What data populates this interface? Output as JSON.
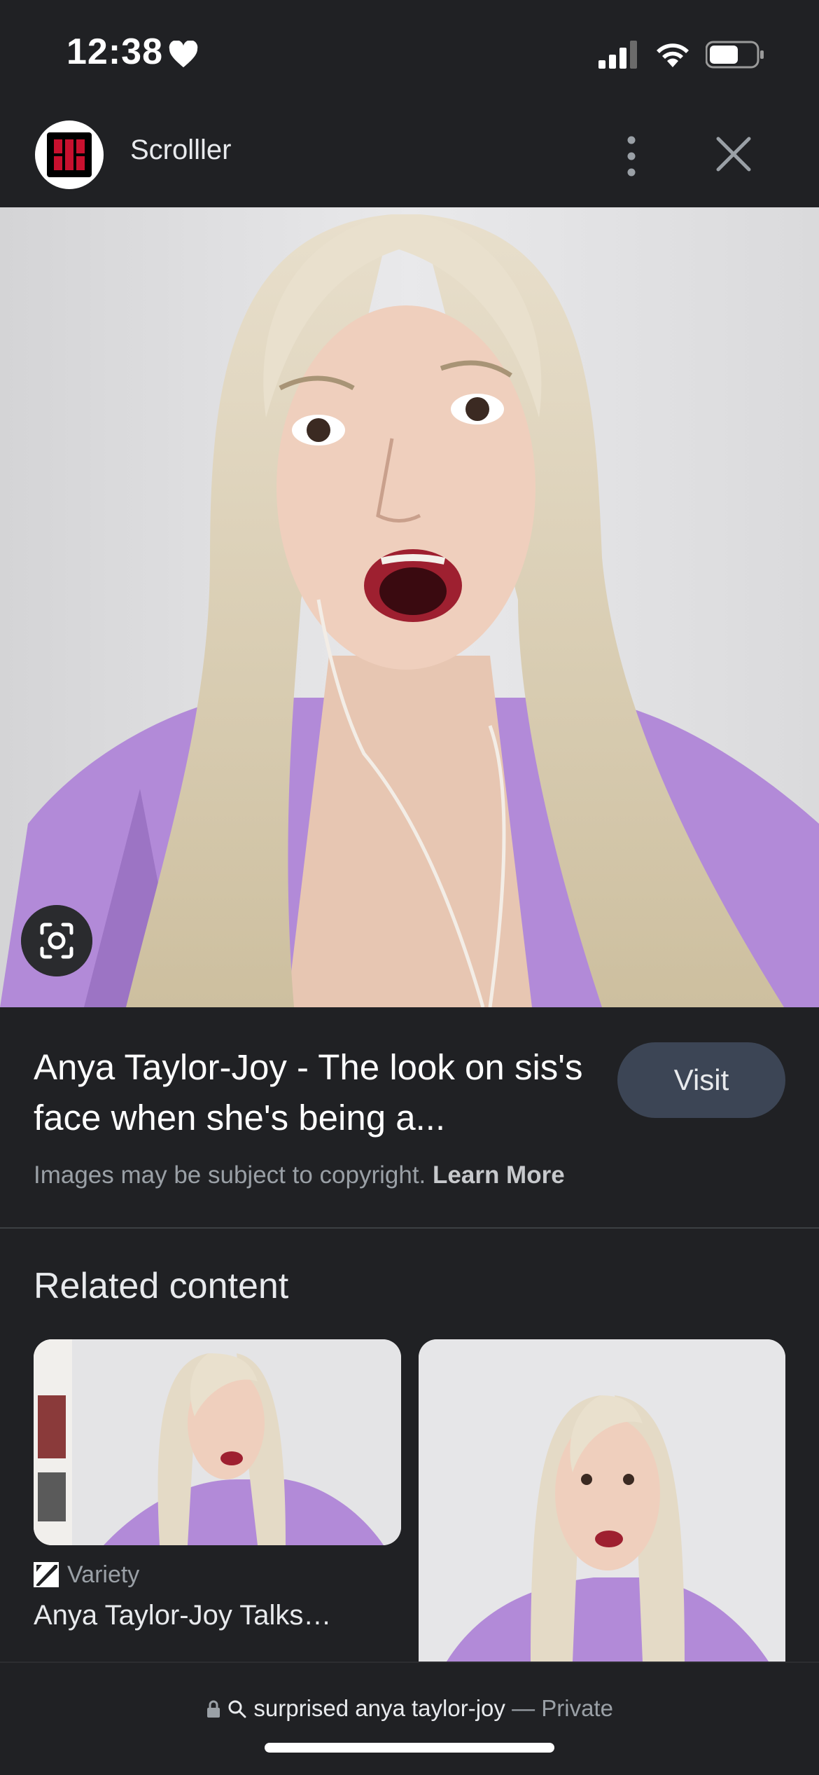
{
  "status_bar": {
    "time": "12:38",
    "icons": [
      "heart-icon",
      "signal-icon",
      "wifi-icon",
      "battery-icon"
    ],
    "battery_level": 0.6
  },
  "header": {
    "site_name": "Scrolller",
    "logo": "scrolller-logo",
    "more_icon": "more-vert-icon",
    "close_icon": "close-icon"
  },
  "hero": {
    "lens_icon": "lens-icon"
  },
  "result": {
    "title": "Anya Taylor-Joy - The look on sis's face when she's being a...",
    "visit_label": "Visit",
    "copyright_text": "Images may be subject to copyright.",
    "learn_more": "Learn More"
  },
  "related": {
    "heading": "Related content",
    "items": [
      {
        "source": "Variety",
        "source_icon": "variety-icon",
        "title": "Anya Taylor-Joy Talks…"
      },
      {
        "source": "",
        "title": ""
      }
    ]
  },
  "bottom_bar": {
    "query": "surprised anya taylor-joy",
    "mode": "— Private",
    "icons": [
      "lock-icon",
      "search-icon"
    ]
  },
  "colors": {
    "background": "#202124",
    "visit_button": "#3c4555",
    "dress": "#b08ad6",
    "hair": "#d9ccb4"
  }
}
